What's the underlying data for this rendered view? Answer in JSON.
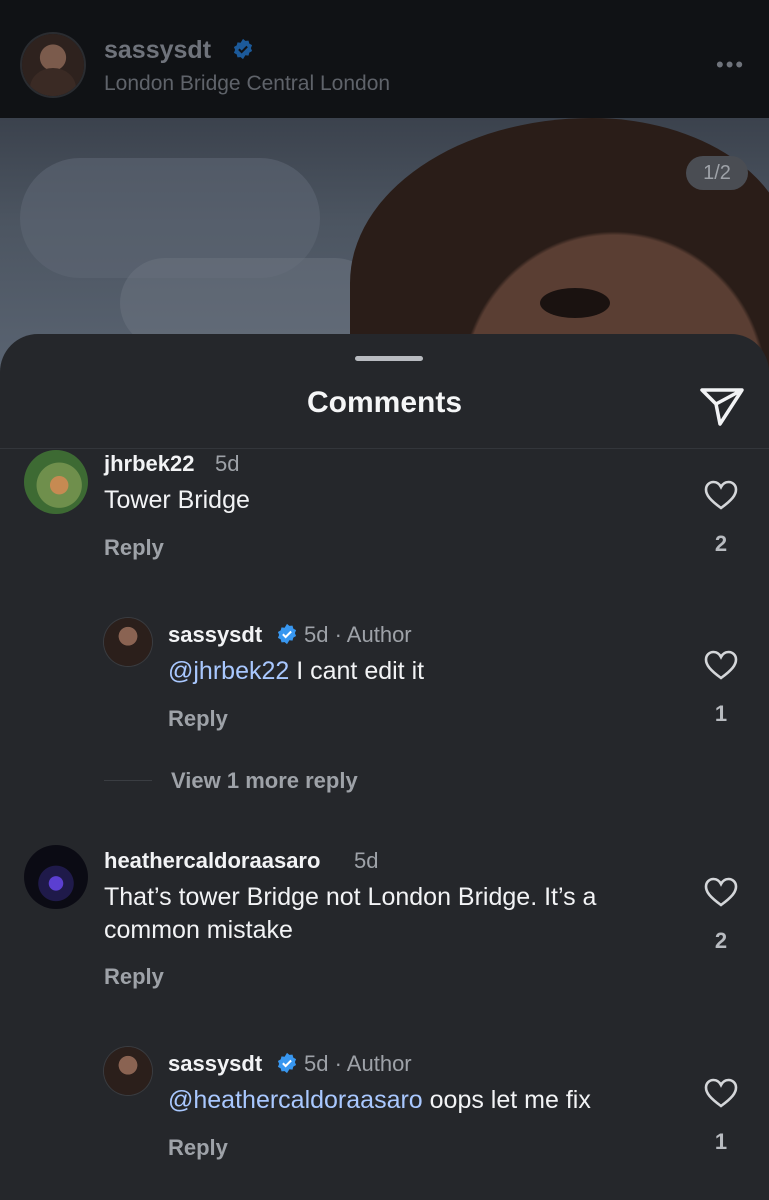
{
  "post": {
    "username": "sassysdt",
    "location": "London Bridge Central London",
    "more": "•••",
    "image_counter": "1/2"
  },
  "sheet": {
    "title": "Comments"
  },
  "comments": [
    {
      "username": "jhrbek22",
      "time": "5d",
      "text": "Tower Bridge",
      "reply": "Reply",
      "likes": "2"
    },
    {
      "username": "sassysdt",
      "time": "5d · Author",
      "mention": "@jhrbek22",
      "text": " I cant edit it",
      "reply": "Reply",
      "likes": "1"
    },
    {
      "view_more": "View 1 more reply"
    },
    {
      "username": "heathercaldoraasaro",
      "time": "5d",
      "text": "That’s tower Bridge not London Bridge. It’s a common mistake",
      "reply": "Reply",
      "likes": "2"
    },
    {
      "username": "sassysdt",
      "time": "5d · Author",
      "mention": "@heathercaldoraasaro",
      "text": " oops let me fix",
      "reply": "Reply",
      "likes": "1"
    }
  ],
  "colors": {
    "sheet_bg": "#25272b",
    "mention": "#a9c8ff",
    "verified": "#3897f0"
  }
}
